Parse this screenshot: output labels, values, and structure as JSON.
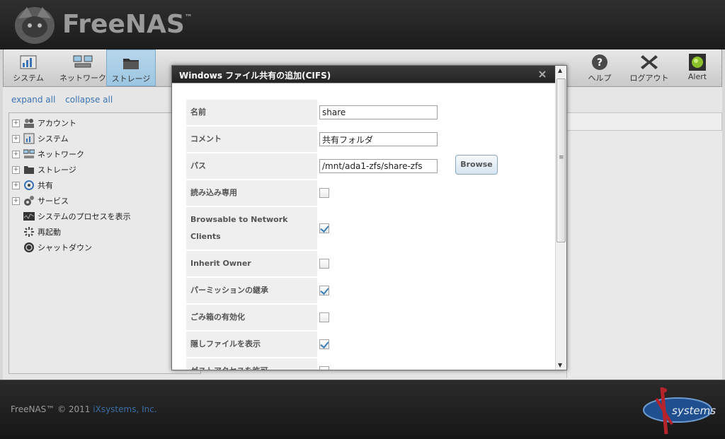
{
  "header": {
    "brand": "FreeNAS",
    "tm": "™"
  },
  "toolbar": {
    "items": [
      {
        "label": "システム",
        "icon": "system-icon"
      },
      {
        "label": "ネットワーク",
        "icon": "network-icon"
      },
      {
        "label": "ストレージ",
        "icon": "storage-icon",
        "active": true
      },
      {
        "label": "ヘルプ",
        "icon": "help-icon"
      },
      {
        "label": "ログアウト",
        "icon": "logout-icon"
      },
      {
        "label": "Alert",
        "icon": "alert-icon"
      }
    ]
  },
  "sidebar": {
    "expand_all": "expand all",
    "collapse_all": "collapse all",
    "tree": [
      {
        "label": "アカウント",
        "expandable": true,
        "icon": "account-icon"
      },
      {
        "label": "システム",
        "expandable": true,
        "icon": "system-icon"
      },
      {
        "label": "ネットワーク",
        "expandable": true,
        "icon": "network-icon"
      },
      {
        "label": "ストレージ",
        "expandable": true,
        "icon": "storage-icon"
      },
      {
        "label": "共有",
        "expandable": true,
        "icon": "share-icon"
      },
      {
        "label": "サービス",
        "expandable": true,
        "icon": "services-icon"
      },
      {
        "label": "システムのプロセスを表示",
        "expandable": false,
        "icon": "processes-icon"
      },
      {
        "label": "再起動",
        "expandable": false,
        "icon": "reboot-icon"
      },
      {
        "label": "シャットダウン",
        "expandable": false,
        "icon": "shutdown-icon"
      }
    ]
  },
  "modal": {
    "title": "Windows ファイル共有の追加(CIFS)",
    "browse_label": "Browse",
    "fields": {
      "name": {
        "label": "名前",
        "value": "share"
      },
      "comment": {
        "label": "コメント",
        "value": "共有フォルダ"
      },
      "path": {
        "label": "パス",
        "value": "/mnt/ada1-zfs/share-zfs"
      },
      "read_only": {
        "label": "読み込み専用",
        "checked": false
      },
      "browsable": {
        "label": "Browsable to Network Clients",
        "checked": true
      },
      "inherit_owner": {
        "label": "Inherit Owner",
        "checked": false
      },
      "inherit_perms": {
        "label": "パーミッションの継承",
        "checked": true
      },
      "recycle_bin": {
        "label": "ごみ箱の有効化",
        "checked": false
      },
      "show_hidden": {
        "label": "隠しファイルを表示",
        "checked": true
      },
      "guest_access": {
        "label": "ゲストアクセスを許可",
        "checked": false
      }
    }
  },
  "footer": {
    "copyright": "FreeNAS™ © 2011",
    "company": "iXsystems, Inc.",
    "logo_text": "systems"
  },
  "colors": {
    "accent": "#3c7fb8",
    "header_bg": "#262626",
    "link": "#3b73b4"
  }
}
